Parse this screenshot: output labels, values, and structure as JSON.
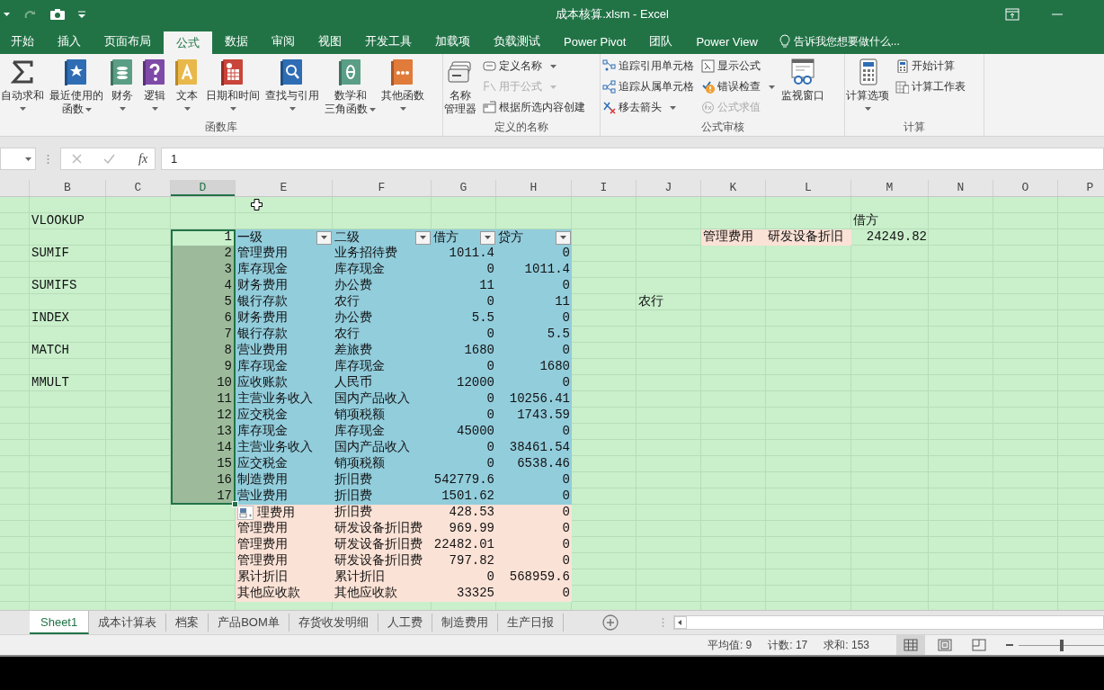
{
  "title_bar": {
    "title": "成本核算.xlsm - Excel"
  },
  "ribbon_tabs": [
    {
      "label": "开始",
      "selected": false
    },
    {
      "label": "插入",
      "selected": false
    },
    {
      "label": "页面布局",
      "selected": false
    },
    {
      "label": "公式",
      "selected": true
    },
    {
      "label": "数据",
      "selected": false
    },
    {
      "label": "审阅",
      "selected": false
    },
    {
      "label": "视图",
      "selected": false
    },
    {
      "label": "开发工具",
      "selected": false
    },
    {
      "label": "加载项",
      "selected": false
    },
    {
      "label": "负载测试",
      "selected": false
    },
    {
      "label": "Power Pivot",
      "selected": false
    },
    {
      "label": "团队",
      "selected": false
    },
    {
      "label": "Power View",
      "selected": false
    }
  ],
  "tell_me": {
    "label": "告诉我您想要做什么..."
  },
  "ribbon": {
    "groups": [
      {
        "label": "函数库",
        "items": [
          {
            "kind": "large",
            "lines": [
              "自动求和"
            ],
            "caret": true
          },
          {
            "kind": "large",
            "lines": [
              "最近使用的",
              "函数"
            ],
            "caret": true
          },
          {
            "kind": "large",
            "lines": [
              "财务"
            ],
            "caret": true
          },
          {
            "kind": "large",
            "lines": [
              "逻辑"
            ],
            "caret": true
          },
          {
            "kind": "large",
            "lines": [
              "文本"
            ],
            "caret": true
          },
          {
            "kind": "large",
            "lines": [
              "日期和时间"
            ],
            "caret": true
          },
          {
            "kind": "large",
            "lines": [
              "查找与引用"
            ],
            "caret": true
          },
          {
            "kind": "large",
            "lines": [
              "数学和",
              "三角函数"
            ],
            "caret": true
          },
          {
            "kind": "large",
            "lines": [
              "其他函数"
            ],
            "caret": true
          }
        ]
      },
      {
        "label": "定义的名称",
        "items": [
          {
            "kind": "large",
            "lines": [
              "名称",
              "管理器"
            ],
            "caret": false
          },
          {
            "kind": "stack",
            "items": [
              {
                "label": "定义名称",
                "caret": true,
                "disabled": false
              },
              {
                "label": "用于公式",
                "caret": true,
                "disabled": true
              },
              {
                "label": "根据所选内容创建",
                "caret": false,
                "disabled": false
              }
            ]
          }
        ]
      },
      {
        "label": "公式审核",
        "items": [
          {
            "kind": "stack",
            "items": [
              {
                "label": "追踪引用单元格",
                "caret": false,
                "disabled": false
              },
              {
                "label": "追踪从属单元格",
                "caret": false,
                "disabled": false
              },
              {
                "label": "移去箭头",
                "caret": true,
                "disabled": false
              }
            ]
          },
          {
            "kind": "stack",
            "items": [
              {
                "label": "显示公式",
                "caret": false,
                "disabled": false
              },
              {
                "label": "错误检查",
                "caret": true,
                "disabled": false
              },
              {
                "label": "公式求值",
                "caret": false,
                "disabled": true
              }
            ]
          },
          {
            "kind": "large",
            "lines": [
              "监视窗口"
            ],
            "caret": false
          }
        ]
      },
      {
        "label": "计算",
        "items": [
          {
            "kind": "large",
            "lines": [
              "计算选项"
            ],
            "caret": true
          },
          {
            "kind": "stack",
            "items": [
              {
                "label": "开始计算",
                "caret": false,
                "disabled": false
              },
              {
                "label": "计算工作表",
                "caret": false,
                "disabled": false
              }
            ]
          }
        ]
      }
    ]
  },
  "formula_bar": {
    "function_button": "fx",
    "value": "1"
  },
  "sheet": {
    "columns": [
      {
        "selected": false
      },
      {
        "label": "B",
        "selected": false
      },
      {
        "label": "C",
        "selected": false
      },
      {
        "label": "D",
        "selected": true
      },
      {
        "label": "E",
        "selected": false
      },
      {
        "label": "F",
        "selected": false
      },
      {
        "label": "G",
        "selected": false
      },
      {
        "label": "H",
        "selected": false
      },
      {
        "label": "I",
        "selected": false
      },
      {
        "label": "J",
        "selected": false
      },
      {
        "label": "K",
        "selected": false
      },
      {
        "label": "L",
        "selected": false
      },
      {
        "label": "M",
        "selected": false
      },
      {
        "label": "N",
        "selected": false
      },
      {
        "label": "O",
        "selected": false
      },
      {
        "label": "P",
        "selected": false
      }
    ],
    "rows": [
      {
        "selected": false,
        "header": false,
        "cursor": true,
        "cells": {}
      },
      {
        "selected": false,
        "header": false,
        "cells": {
          "B": {
            "text": "VLOOKUP"
          },
          "M": {
            "text": "借方"
          }
        }
      },
      {
        "selected": true,
        "header": true,
        "cells": {
          "D": {
            "text": "1"
          },
          "E": {
            "text": "一级",
            "color": "#92cddc"
          },
          "F": {
            "text": "二级",
            "color": "#92cddc"
          },
          "G": {
            "text": "借方",
            "color": "#92cddc"
          },
          "H": {
            "text": "贷方",
            "color": "#92cddc"
          },
          "K": {
            "text": "管理费用",
            "color": "#fbe2d6"
          },
          "L": {
            "text": "研发设备折旧",
            "color": "#fbe2d6"
          },
          "M": {
            "text": "24249.82"
          }
        }
      },
      {
        "selected": true,
        "header": false,
        "cells": {
          "B": {
            "text": "SUMIF"
          },
          "D": {
            "text": "2"
          },
          "E": {
            "text": "管理费用",
            "color": "#92cddc"
          },
          "F": {
            "text": "业务招待费",
            "color": "#92cddc"
          },
          "G": {
            "text": "1011.4",
            "color": "#92cddc"
          },
          "H": {
            "text": "0",
            "color": "#92cddc"
          }
        }
      },
      {
        "selected": true,
        "header": false,
        "cells": {
          "D": {
            "text": "3"
          },
          "E": {
            "text": "库存现金",
            "color": "#92cddc"
          },
          "F": {
            "text": "库存现金",
            "color": "#92cddc"
          },
          "G": {
            "text": "0",
            "color": "#92cddc"
          },
          "H": {
            "text": "1011.4",
            "color": "#92cddc"
          }
        }
      },
      {
        "selected": true,
        "header": false,
        "cells": {
          "B": {
            "text": "SUMIFS"
          },
          "D": {
            "text": "4"
          },
          "E": {
            "text": "财务费用",
            "color": "#92cddc"
          },
          "F": {
            "text": "办公费",
            "color": "#92cddc"
          },
          "G": {
            "text": "11",
            "color": "#92cddc"
          },
          "H": {
            "text": "0",
            "color": "#92cddc"
          }
        }
      },
      {
        "selected": true,
        "header": false,
        "cells": {
          "D": {
            "text": "5"
          },
          "E": {
            "text": "银行存款",
            "color": "#92cddc"
          },
          "F": {
            "text": "农行",
            "color": "#92cddc"
          },
          "G": {
            "text": "0",
            "color": "#92cddc"
          },
          "H": {
            "text": "11",
            "color": "#92cddc"
          },
          "J": {
            "text": "农行"
          }
        }
      },
      {
        "selected": true,
        "header": false,
        "cells": {
          "B": {
            "text": "INDEX"
          },
          "D": {
            "text": "6"
          },
          "E": {
            "text": "财务费用",
            "color": "#92cddc"
          },
          "F": {
            "text": "办公费",
            "color": "#92cddc"
          },
          "G": {
            "text": "5.5",
            "color": "#92cddc"
          },
          "H": {
            "text": "0",
            "color": "#92cddc"
          }
        }
      },
      {
        "selected": true,
        "header": false,
        "cells": {
          "D": {
            "text": "7"
          },
          "E": {
            "text": "银行存款",
            "color": "#92cddc"
          },
          "F": {
            "text": "农行",
            "color": "#92cddc"
          },
          "G": {
            "text": "0",
            "color": "#92cddc"
          },
          "H": {
            "text": "5.5",
            "color": "#92cddc"
          }
        }
      },
      {
        "selected": true,
        "header": false,
        "cells": {
          "B": {
            "text": "MATCH"
          },
          "D": {
            "text": "8"
          },
          "E": {
            "text": "营业费用",
            "color": "#92cddc"
          },
          "F": {
            "text": "差旅费",
            "color": "#92cddc"
          },
          "G": {
            "text": "1680",
            "color": "#92cddc"
          },
          "H": {
            "text": "0",
            "color": "#92cddc"
          }
        }
      },
      {
        "selected": true,
        "header": false,
        "cells": {
          "D": {
            "text": "9"
          },
          "E": {
            "text": "库存现金",
            "color": "#92cddc"
          },
          "F": {
            "text": "库存现金",
            "color": "#92cddc"
          },
          "G": {
            "text": "0",
            "color": "#92cddc"
          },
          "H": {
            "text": "1680",
            "color": "#92cddc"
          }
        }
      },
      {
        "selected": true,
        "header": false,
        "cells": {
          "B": {
            "text": "MMULT"
          },
          "D": {
            "text": "10"
          },
          "E": {
            "text": "应收账款",
            "color": "#92cddc"
          },
          "F": {
            "text": "人民币",
            "color": "#92cddc"
          },
          "G": {
            "text": "12000",
            "color": "#92cddc"
          },
          "H": {
            "text": "0",
            "color": "#92cddc"
          }
        }
      },
      {
        "selected": true,
        "header": false,
        "cells": {
          "D": {
            "text": "11"
          },
          "E": {
            "text": "主营业务收入",
            "color": "#92cddc"
          },
          "F": {
            "text": "国内产品收入",
            "color": "#92cddc"
          },
          "G": {
            "text": "0",
            "color": "#92cddc"
          },
          "H": {
            "text": "10256.41",
            "color": "#92cddc"
          }
        }
      },
      {
        "selected": true,
        "header": false,
        "cells": {
          "D": {
            "text": "12"
          },
          "E": {
            "text": "应交税金",
            "color": "#92cddc"
          },
          "F": {
            "text": "销项税额",
            "color": "#92cddc"
          },
          "G": {
            "text": "0",
            "color": "#92cddc"
          },
          "H": {
            "text": "1743.59",
            "color": "#92cddc"
          }
        }
      },
      {
        "selected": true,
        "header": false,
        "cells": {
          "D": {
            "text": "13"
          },
          "E": {
            "text": "库存现金",
            "color": "#92cddc"
          },
          "F": {
            "text": "库存现金",
            "color": "#92cddc"
          },
          "G": {
            "text": "45000",
            "color": "#92cddc"
          },
          "H": {
            "text": "0",
            "color": "#92cddc"
          }
        }
      },
      {
        "selected": true,
        "header": false,
        "cells": {
          "D": {
            "text": "14"
          },
          "E": {
            "text": "主营业务收入",
            "color": "#92cddc"
          },
          "F": {
            "text": "国内产品收入",
            "color": "#92cddc"
          },
          "G": {
            "text": "0",
            "color": "#92cddc"
          },
          "H": {
            "text": "38461.54",
            "color": "#92cddc"
          }
        }
      },
      {
        "selected": true,
        "header": false,
        "cells": {
          "D": {
            "text": "15"
          },
          "E": {
            "text": "应交税金",
            "color": "#92cddc"
          },
          "F": {
            "text": "销项税额",
            "color": "#92cddc"
          },
          "G": {
            "text": "0",
            "color": "#92cddc"
          },
          "H": {
            "text": "6538.46",
            "color": "#92cddc"
          }
        }
      },
      {
        "selected": true,
        "header": false,
        "cells": {
          "D": {
            "text": "16"
          },
          "E": {
            "text": "制造费用",
            "color": "#92cddc"
          },
          "F": {
            "text": "折旧费",
            "color": "#92cddc"
          },
          "G": {
            "text": "542779.6",
            "color": "#92cddc"
          },
          "H": {
            "text": "0",
            "color": "#92cddc"
          }
        }
      },
      {
        "selected": true,
        "header": false,
        "cells": {
          "D": {
            "text": "17"
          },
          "E": {
            "text": "营业费用",
            "color": "#92cddc"
          },
          "F": {
            "text": "折旧费",
            "color": "#92cddc"
          },
          "G": {
            "text": "1501.62",
            "color": "#92cddc"
          },
          "H": {
            "text": "0",
            "color": "#92cddc"
          }
        }
      },
      {
        "selected": false,
        "header": false,
        "paste_icon": true,
        "cells": {
          "E": {
            "text": "理费用",
            "color": "#fbe2d6"
          },
          "F": {
            "text": "折旧费",
            "color": "#fbe2d6"
          },
          "G": {
            "text": "428.53",
            "color": "#fbe2d6"
          },
          "H": {
            "text": "0",
            "color": "#fbe2d6"
          }
        }
      },
      {
        "selected": false,
        "header": false,
        "cells": {
          "E": {
            "text": "管理费用",
            "color": "#fbe2d6"
          },
          "F": {
            "text": "研发设备折旧费",
            "color": "#fbe2d6"
          },
          "G": {
            "text": "969.99",
            "color": "#fbe2d6"
          },
          "H": {
            "text": "0",
            "color": "#fbe2d6"
          }
        }
      },
      {
        "selected": false,
        "header": false,
        "cells": {
          "E": {
            "text": "管理费用",
            "color": "#fbe2d6"
          },
          "F": {
            "text": "研发设备折旧费",
            "color": "#fbe2d6"
          },
          "G": {
            "text": "22482.01",
            "color": "#fbe2d6"
          },
          "H": {
            "text": "0",
            "color": "#fbe2d6"
          }
        }
      },
      {
        "selected": false,
        "header": false,
        "cells": {
          "E": {
            "text": "管理费用",
            "color": "#fbe2d6"
          },
          "F": {
            "text": "研发设备折旧费",
            "color": "#fbe2d6"
          },
          "G": {
            "text": "797.82",
            "color": "#fbe2d6"
          },
          "H": {
            "text": "0",
            "color": "#fbe2d6"
          }
        }
      },
      {
        "selected": false,
        "header": false,
        "cells": {
          "E": {
            "text": "累计折旧",
            "color": "#fbe2d6"
          },
          "F": {
            "text": "累计折旧",
            "color": "#fbe2d6"
          },
          "G": {
            "text": "0",
            "color": "#fbe2d6"
          },
          "H": {
            "text": "568959.6",
            "color": "#fbe2d6"
          }
        }
      },
      {
        "selected": false,
        "header": false,
        "cells": {
          "E": {
            "text": "其他应收款",
            "color": "#fbe2d6"
          },
          "F": {
            "text": "其他应收款",
            "color": "#fbe2d6"
          },
          "G": {
            "text": "33325",
            "color": "#fbe2d6"
          },
          "H": {
            "text": "0",
            "color": "#fbe2d6"
          }
        }
      }
    ]
  },
  "sheet_tabs": [
    {
      "label": "Sheet1",
      "selected": true
    },
    {
      "label": "成本计算表",
      "selected": false
    },
    {
      "label": "档案",
      "selected": false
    },
    {
      "label": "产品BOM单",
      "selected": false
    },
    {
      "label": "存货收发明细",
      "selected": false
    },
    {
      "label": "人工费",
      "selected": false
    },
    {
      "label": "制造费用",
      "selected": false
    },
    {
      "label": "生产日报",
      "selected": false
    }
  ],
  "status_bar": {
    "stats": [
      "平均值: 9",
      "计数: 17",
      "求和: 153"
    ],
    "views": [
      {
        "selected": true
      },
      {
        "selected": false
      },
      {
        "selected": false
      }
    ],
    "zoom": {
      "level": 0.5
    }
  }
}
